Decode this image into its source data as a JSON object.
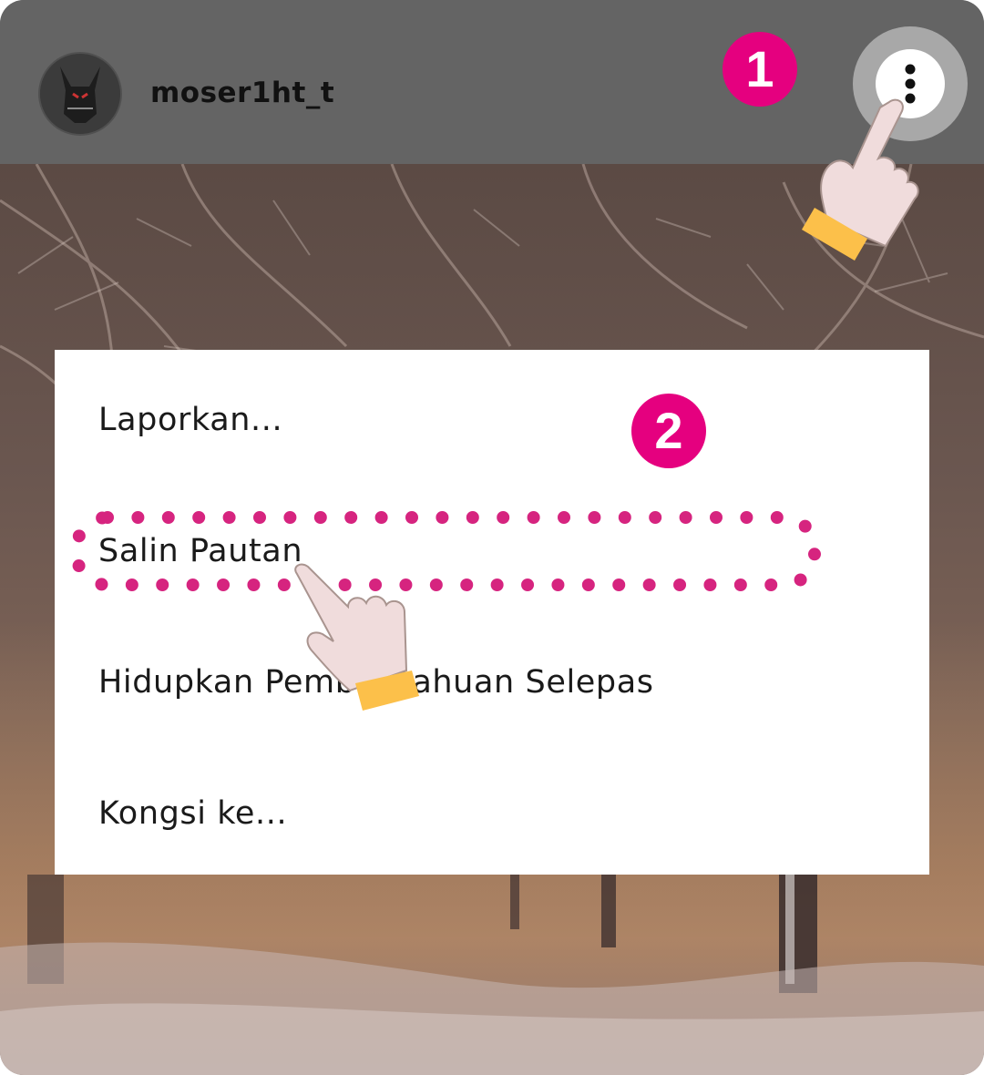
{
  "header": {
    "username": "moser1ht_t",
    "more_menu_icon": "vertical-ellipsis-icon",
    "avatar_icon": "profile-avatar"
  },
  "steps": {
    "step_1": "1",
    "step_2": "2"
  },
  "popup_menu": {
    "items": [
      {
        "label": "Laporkan..."
      },
      {
        "label": "Salin Pautan"
      },
      {
        "label": "Hidupkan Pemberitahuan Selepas"
      },
      {
        "label": "Kongsi ke..."
      }
    ],
    "highlighted_item": "Salin Pautan"
  },
  "colors": {
    "badge": "#e5007f",
    "highlight_dots": "#d6247f",
    "header_bg": "#646464",
    "hand_fill": "#f0dcdc",
    "cuff": "#fcc04a"
  }
}
